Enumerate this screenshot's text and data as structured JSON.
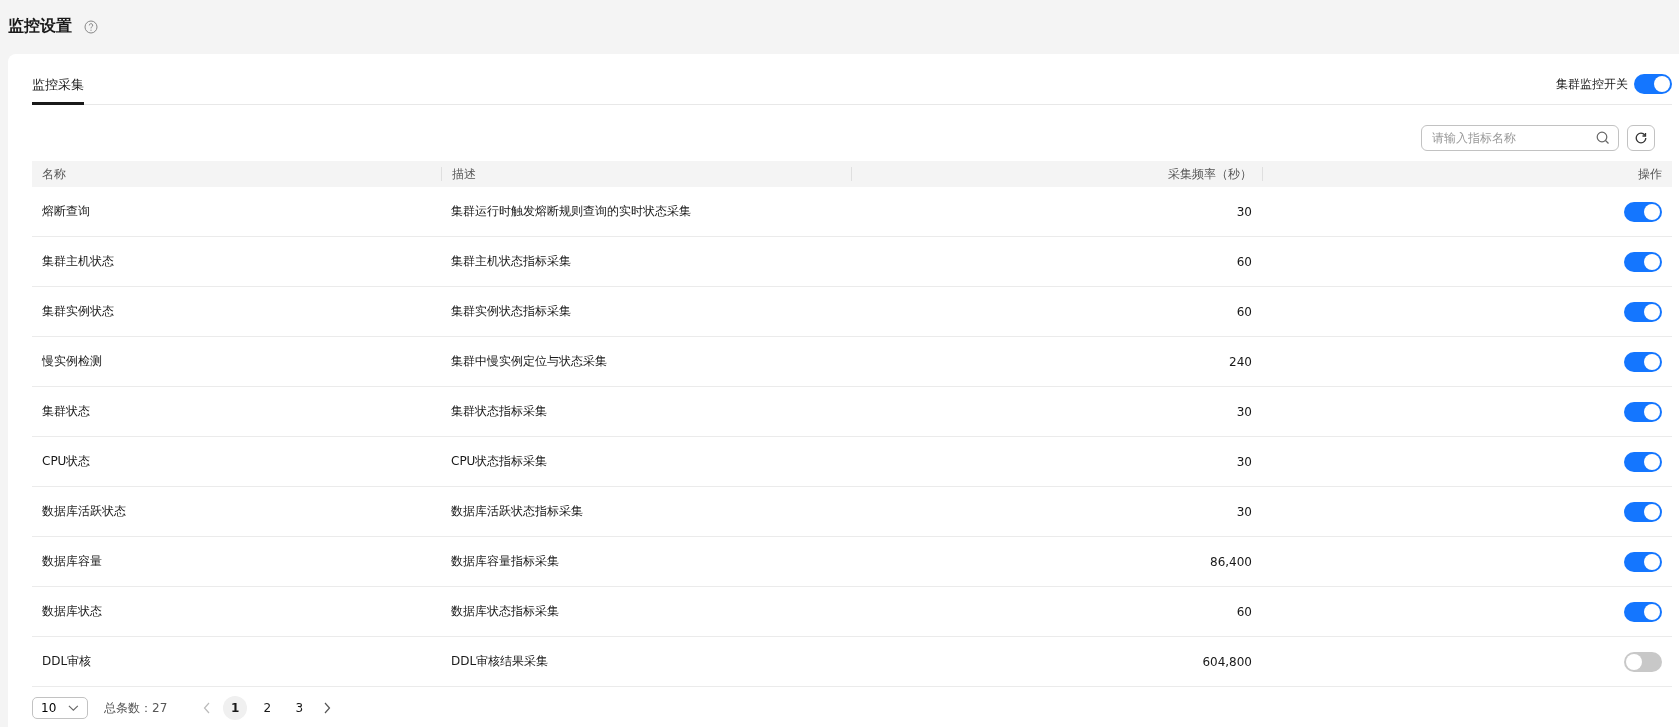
{
  "page": {
    "title": "监控设置"
  },
  "tabs": [
    {
      "label": "监控采集",
      "selected": true
    }
  ],
  "cluster_switch": {
    "label": "集群监控开关",
    "on": true
  },
  "search": {
    "placeholder": "请输入指标名称"
  },
  "table": {
    "columns": [
      "名称",
      "描述",
      "采集频率（秒）",
      "操作"
    ],
    "rows": [
      {
        "name": "熔断查询",
        "description": "集群运行时触发熔断规则查询的实时状态采集",
        "frequency": "30",
        "on": true
      },
      {
        "name": "集群主机状态",
        "description": "集群主机状态指标采集",
        "frequency": "60",
        "on": true
      },
      {
        "name": "集群实例状态",
        "description": "集群实例状态指标采集",
        "frequency": "60",
        "on": true
      },
      {
        "name": "慢实例检测",
        "description": "集群中慢实例定位与状态采集",
        "frequency": "240",
        "on": true
      },
      {
        "name": "集群状态",
        "description": "集群状态指标采集",
        "frequency": "30",
        "on": true
      },
      {
        "name": "CPU状态",
        "description": "CPU状态指标采集",
        "frequency": "30",
        "on": true
      },
      {
        "name": "数据库活跃状态",
        "description": "数据库活跃状态指标采集",
        "frequency": "30",
        "on": true
      },
      {
        "name": "数据库容量",
        "description": "数据库容量指标采集",
        "frequency": "86,400",
        "on": true
      },
      {
        "name": "数据库状态",
        "description": "数据库状态指标采集",
        "frequency": "60",
        "on": true
      },
      {
        "name": "DDL审核",
        "description": "DDL审核结果采集",
        "frequency": "604,800",
        "on": false
      }
    ]
  },
  "pagination": {
    "page_size": "10",
    "total": "总条数：27",
    "pages": [
      {
        "label": "1",
        "selected": true
      },
      {
        "label": "2",
        "selected": false
      },
      {
        "label": "3",
        "selected": false
      }
    ]
  }
}
